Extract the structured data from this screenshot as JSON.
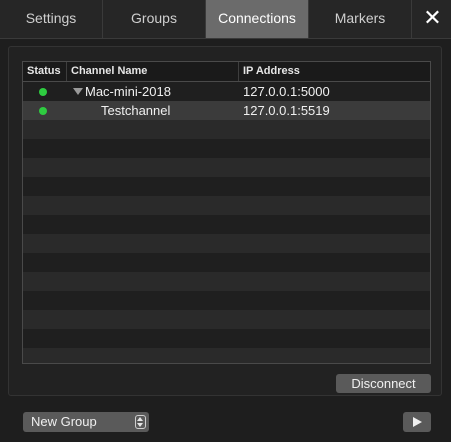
{
  "tabs": [
    {
      "label": "Settings",
      "active": false
    },
    {
      "label": "Groups",
      "active": false
    },
    {
      "label": "Connections",
      "active": true
    },
    {
      "label": "Markers",
      "active": false
    }
  ],
  "close_icon": "close-icon",
  "table": {
    "columns": [
      "Status",
      "Channel Name",
      "IP Address"
    ],
    "rows": [
      {
        "status": "online",
        "name": "Mac-mini-2018",
        "ip": "127.0.0.1:5000",
        "expanded": true,
        "level": 0
      },
      {
        "status": "online",
        "name": "Testchannel",
        "ip": "127.0.0.1:5519",
        "level": 1,
        "selected": true
      }
    ],
    "status_color": "#2ecc40"
  },
  "buttons": {
    "disconnect": "Disconnect",
    "play_icon": "play-icon"
  },
  "group_select": {
    "value": "New Group"
  }
}
